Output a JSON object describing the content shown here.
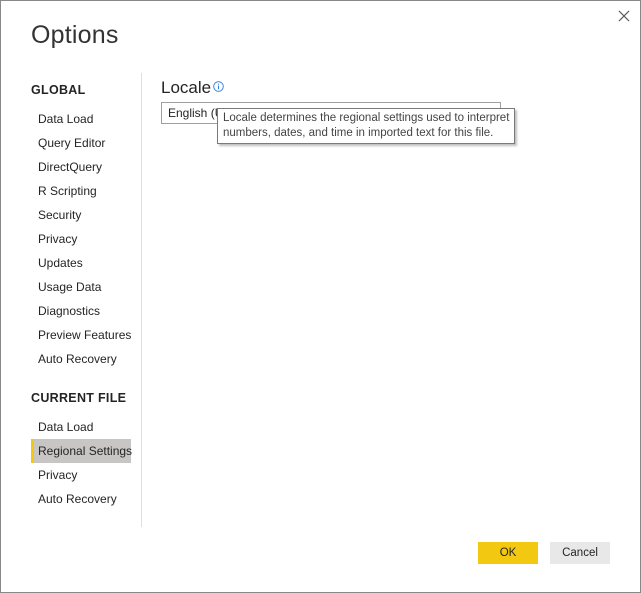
{
  "dialog": {
    "title": "Options"
  },
  "nav": {
    "global_header": "GLOBAL",
    "global_items": [
      {
        "label": "Data Load"
      },
      {
        "label": "Query Editor"
      },
      {
        "label": "DirectQuery"
      },
      {
        "label": "R Scripting"
      },
      {
        "label": "Security"
      },
      {
        "label": "Privacy"
      },
      {
        "label": "Updates"
      },
      {
        "label": "Usage Data"
      },
      {
        "label": "Diagnostics"
      },
      {
        "label": "Preview Features"
      },
      {
        "label": "Auto Recovery"
      }
    ],
    "current_header": "CURRENT FILE",
    "current_items": [
      {
        "label": "Data Load"
      },
      {
        "label": "Regional Settings",
        "selected": true
      },
      {
        "label": "Privacy"
      },
      {
        "label": "Auto Recovery"
      }
    ]
  },
  "locale": {
    "heading": "Locale",
    "selected_value": "English (U",
    "tooltip": "Locale determines the regional settings used to interpret numbers, dates, and time in imported text for this file."
  },
  "buttons": {
    "ok": "OK",
    "cancel": "Cancel"
  },
  "colors": {
    "accent": "#f2c811",
    "selected_bg": "#c8c6c4",
    "cancel_bg": "#e8e8e8"
  },
  "icons": {
    "close": "close-icon",
    "info": "info-icon"
  }
}
